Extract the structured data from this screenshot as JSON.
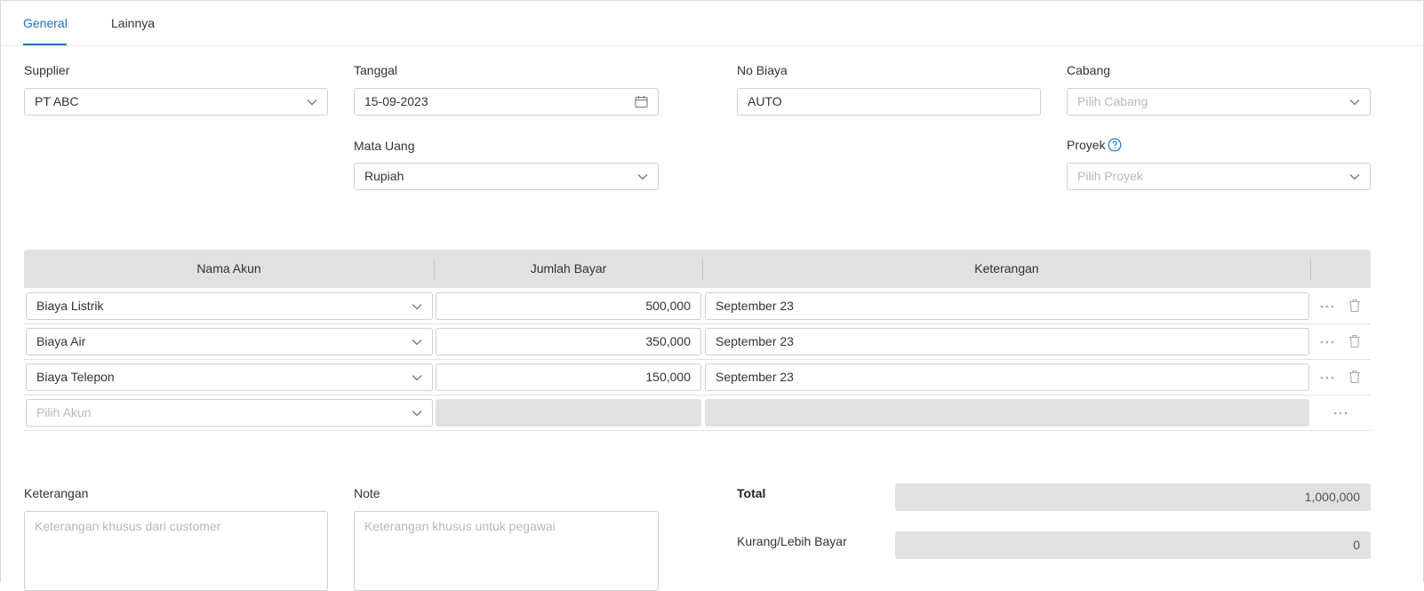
{
  "tabs": [
    {
      "label": "General",
      "active": true
    },
    {
      "label": "Lainnya",
      "active": false
    }
  ],
  "form": {
    "supplier": {
      "label": "Supplier",
      "value": "PT ABC"
    },
    "tanggal": {
      "label": "Tanggal",
      "value": "15-09-2023"
    },
    "no_biaya": {
      "label": "No Biaya",
      "value": "AUTO"
    },
    "cabang": {
      "label": "Cabang",
      "placeholder": "Pilih Cabang"
    },
    "mata_uang": {
      "label": "Mata Uang",
      "value": "Rupiah"
    },
    "proyek": {
      "label": "Proyek",
      "placeholder": "Pilih Proyek"
    }
  },
  "table": {
    "columns": [
      "Nama Akun",
      "Jumlah Bayar",
      "Keterangan"
    ],
    "rows": [
      {
        "akun": "Biaya Listrik",
        "jumlah": "500,000",
        "keterangan": "September 23"
      },
      {
        "akun": "Biaya Air",
        "jumlah": "350,000",
        "keterangan": "September 23"
      },
      {
        "akun": "Biaya Telepon",
        "jumlah": "150,000",
        "keterangan": "September 23"
      }
    ],
    "new_row_placeholder": "Pilih Akun"
  },
  "footer": {
    "keterangan": {
      "label": "Keterangan",
      "placeholder": "Keterangan khusus dari customer"
    },
    "note": {
      "label": "Note",
      "placeholder": "Keterangan khusus untuk pegawai"
    },
    "total": {
      "label": "Total",
      "value": "1,000,000"
    },
    "kurang_lebih": {
      "label": "Kurang/Lebih Bayar",
      "value": "0"
    }
  },
  "colors": {
    "accent": "#1a73c8",
    "header_bg": "#e1e1e1",
    "border": "#d0d0d0",
    "placeholder": "#b8b8b8"
  }
}
